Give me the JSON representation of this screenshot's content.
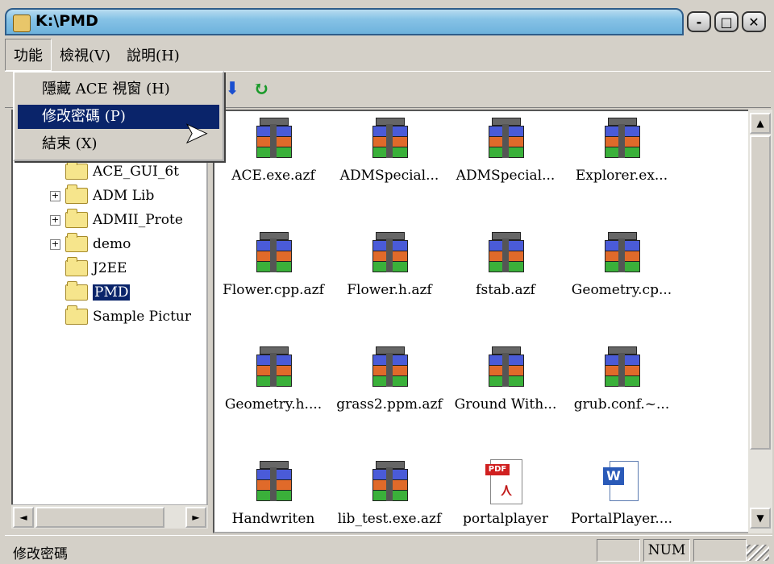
{
  "window": {
    "title": "K:\\PMD",
    "btn_min": "-",
    "btn_max": "□",
    "btn_close": "✕"
  },
  "menubar": [
    {
      "label": "功能"
    },
    {
      "label": "檢視(V)"
    },
    {
      "label": "說明(H)"
    }
  ],
  "dropdown": [
    {
      "label": "隱藏 ACE 視窗 (H)"
    },
    {
      "label": "修改密碼 (P)"
    },
    {
      "label": "結束 (X)"
    }
  ],
  "tree": {
    "nodes": [
      {
        "label": "ACE_GUI_6t",
        "expandable": false
      },
      {
        "label": "ADM Lib",
        "expandable": true
      },
      {
        "label": "ADMII_Prote",
        "expandable": true
      },
      {
        "label": "demo",
        "expandable": true
      },
      {
        "label": "J2EE",
        "expandable": false
      },
      {
        "label": "PMD",
        "expandable": false,
        "selected": true
      },
      {
        "label": "Sample Pictur",
        "expandable": false
      }
    ],
    "plus": "+"
  },
  "files": [
    {
      "label": "ACE.exe.azf",
      "icon": "archive-icon"
    },
    {
      "label": "ADMSpecial...",
      "icon": "archive-icon"
    },
    {
      "label": "ADMSpecial...",
      "icon": "archive-icon"
    },
    {
      "label": "Explorer.ex...",
      "icon": "archive-icon"
    },
    {
      "label": "Flower.cpp.azf",
      "icon": "archive-icon"
    },
    {
      "label": "Flower.h.azf",
      "icon": "archive-icon"
    },
    {
      "label": "fstab.azf",
      "icon": "archive-icon"
    },
    {
      "label": "Geometry.cp...",
      "icon": "archive-icon"
    },
    {
      "label": "Geometry.h....",
      "icon": "archive-icon"
    },
    {
      "label": "grass2.ppm.azf",
      "icon": "archive-icon"
    },
    {
      "label": "Ground With...",
      "icon": "archive-icon"
    },
    {
      "label": "grub.conf.~...",
      "icon": "archive-icon"
    },
    {
      "label": "Handwriten",
      "icon": "archive-icon"
    },
    {
      "label": "lib_test.exe.azf",
      "icon": "archive-icon"
    },
    {
      "label": "portalplayer",
      "icon": "pdf-icon"
    },
    {
      "label": "PortalPlayer....",
      "icon": "word-doc-icon"
    }
  ],
  "pdf_tag": "PDF",
  "word_tag": "W",
  "status": {
    "text": "修改密碼",
    "num": "NUM"
  },
  "scroll": {
    "left": "◄",
    "right": "►",
    "up": "▲",
    "down": "▼"
  }
}
